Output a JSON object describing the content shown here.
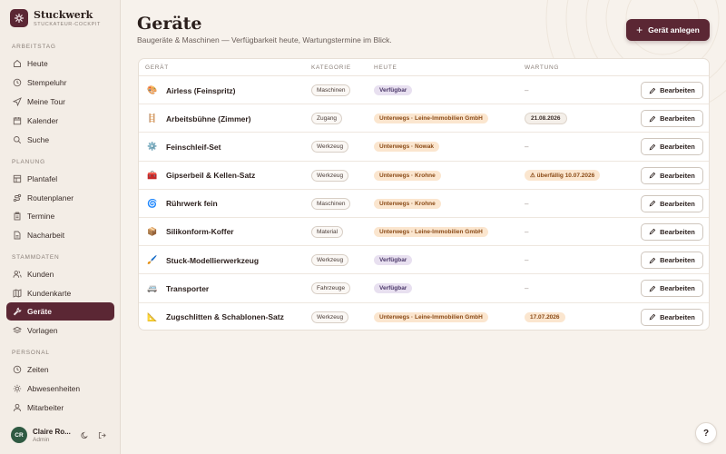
{
  "brand": {
    "name": "Stuckwerk",
    "subtitle": "STUCKATEUR-COCKPIT"
  },
  "sidebar": {
    "sections": [
      {
        "title": "ARBEITSTAG",
        "items": [
          {
            "label": "Heute",
            "icon": "home-icon"
          },
          {
            "label": "Stempeluhr",
            "icon": "clock-icon"
          },
          {
            "label": "Meine Tour",
            "icon": "send-icon"
          },
          {
            "label": "Kalender",
            "icon": "calendar-icon"
          },
          {
            "label": "Suche",
            "icon": "search-icon"
          }
        ]
      },
      {
        "title": "PLANUNG",
        "items": [
          {
            "label": "Plantafel",
            "icon": "grid-icon"
          },
          {
            "label": "Routenplaner",
            "icon": "route-icon"
          },
          {
            "label": "Termine",
            "icon": "clipboard-icon"
          },
          {
            "label": "Nacharbeit",
            "icon": "file-icon"
          }
        ]
      },
      {
        "title": "STAMMDATEN",
        "items": [
          {
            "label": "Kunden",
            "icon": "users-icon"
          },
          {
            "label": "Kundenkarte",
            "icon": "map-icon"
          },
          {
            "label": "Geräte",
            "icon": "wrench-icon",
            "active": true
          },
          {
            "label": "Vorlagen",
            "icon": "layers-icon"
          }
        ]
      },
      {
        "title": "PERSONAL",
        "items": [
          {
            "label": "Zeiten",
            "icon": "clock-icon"
          },
          {
            "label": "Abwesenheiten",
            "icon": "sun-icon"
          },
          {
            "label": "Mitarbeiter",
            "icon": "user-icon"
          }
        ]
      }
    ]
  },
  "user": {
    "initials": "CR",
    "name": "Claire Ro...",
    "role": "Admin"
  },
  "page": {
    "title": "Geräte",
    "subtitle": "Baugeräte & Maschinen — Verfügbarkeit heute, Wartungstermine im Blick.",
    "create_button": "Gerät anlegen"
  },
  "table": {
    "headers": {
      "name": "GERÄT",
      "category": "KATEGORIE",
      "today": "HEUTE",
      "maintenance": "WARTUNG"
    },
    "edit_label": "Bearbeiten",
    "rows": [
      {
        "emoji": "🎨",
        "name": "Airless (Feinspritz)",
        "category": "Maschinen",
        "status": "Verfügbar",
        "status_type": "available",
        "maintenance": "–",
        "maintenance_type": "none"
      },
      {
        "emoji": "🪜",
        "name": "Arbeitsbühne (Zimmer)",
        "category": "Zugang",
        "status": "Unterwegs · Leine-Immobilien GmbH",
        "status_type": "away",
        "maintenance": "21.08.2026",
        "maintenance_type": "normal"
      },
      {
        "emoji": "⚙️",
        "name": "Feinschleif-Set",
        "category": "Werkzeug",
        "status": "Unterwegs · Nowak",
        "status_type": "away",
        "maintenance": "–",
        "maintenance_type": "none"
      },
      {
        "emoji": "🧰",
        "name": "Gipserbeil & Kellen-Satz",
        "category": "Werkzeug",
        "status": "Unterwegs · Krohne",
        "status_type": "away",
        "maintenance": "⚠ überfällig 10.07.2026",
        "maintenance_type": "warn"
      },
      {
        "emoji": "🌀",
        "name": "Rührwerk fein",
        "category": "Maschinen",
        "status": "Unterwegs · Krohne",
        "status_type": "away",
        "maintenance": "–",
        "maintenance_type": "none"
      },
      {
        "emoji": "📦",
        "name": "Silikonform-Koffer",
        "category": "Material",
        "status": "Unterwegs · Leine-Immobilien GmbH",
        "status_type": "away",
        "maintenance": "–",
        "maintenance_type": "none"
      },
      {
        "emoji": "🖌️",
        "name": "Stuck-Modellierwerkzeug",
        "category": "Werkzeug",
        "status": "Verfügbar",
        "status_type": "available",
        "maintenance": "–",
        "maintenance_type": "none"
      },
      {
        "emoji": "🚐",
        "name": "Transporter",
        "category": "Fahrzeuge",
        "status": "Verfügbar",
        "status_type": "available",
        "maintenance": "–",
        "maintenance_type": "none"
      },
      {
        "emoji": "📐",
        "name": "Zugschlitten & Schablonen-Satz",
        "category": "Werkzeug",
        "status": "Unterwegs · Leine-Immobilien GmbH",
        "status_type": "away",
        "maintenance": "17.07.2026",
        "maintenance_type": "warn"
      }
    ]
  },
  "help": {
    "label": "?"
  },
  "colors": {
    "brand": "#5b2734",
    "available_bg": "#e8e0f0",
    "away_bg": "#fbe6cf",
    "avatar": "#2f5a42"
  }
}
